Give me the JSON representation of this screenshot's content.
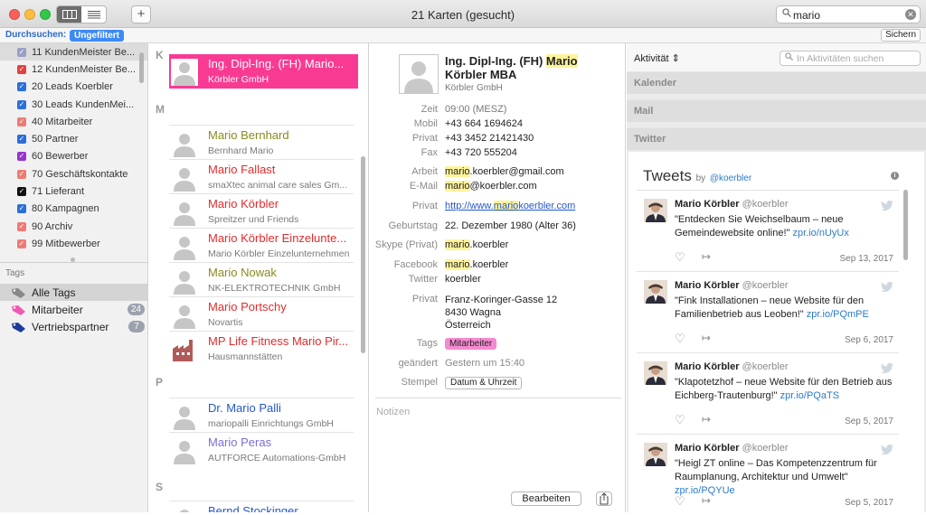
{
  "window": {
    "title": "21 Karten (gesucht)",
    "search_value": "mario",
    "new_button": "+"
  },
  "filter": {
    "label": "Durchsuchen:",
    "pill": "Ungefiltert",
    "save": "Sichern"
  },
  "sidebar": {
    "groups": [
      {
        "label": "11 KundenMeister Be...",
        "color": "#9aa0c4",
        "selected": true
      },
      {
        "label": "12 KundenMeister Be...",
        "color": "#e2413e"
      },
      {
        "label": "20 Leads Koerbler",
        "color": "#2b6fd8"
      },
      {
        "label": "30 Leads KundenMei...",
        "color": "#2b6fd8"
      },
      {
        "label": "40 Mitarbeiter",
        "color": "#ef7a74"
      },
      {
        "label": "50 Partner",
        "color": "#2b6fd8"
      },
      {
        "label": "60 Bewerber",
        "color": "#9a32cf"
      },
      {
        "label": "70 Geschäftskontakte",
        "color": "#ef7a74"
      },
      {
        "label": "71 Lieferant",
        "color": "#111111"
      },
      {
        "label": "80 Kampagnen",
        "color": "#2b6fd8"
      },
      {
        "label": "90 Archiv",
        "color": "#ef7a74"
      },
      {
        "label": "99 Mitbewerber",
        "color": "#ef7a74"
      }
    ],
    "tags_header": "Tags",
    "tags": [
      {
        "label": "Alle Tags",
        "color": "#888888"
      },
      {
        "label": "Mitarbeiter",
        "count": "24",
        "color": "#f05ab2"
      },
      {
        "label": "Vertriebspartner",
        "count": "7",
        "color": "#1d3b9c"
      }
    ]
  },
  "list": {
    "sections": [
      "K",
      "M",
      "P",
      "S"
    ],
    "cards": [
      {
        "name": "Ing. Dipl-Ing. (FH) Mario...",
        "company": "Körbler GmbH",
        "selected": true
      },
      {
        "name": "Mario Bernhard",
        "company": "Bernhard Mario",
        "color": "#8a8a1e"
      },
      {
        "name": "Mario Fallast",
        "company": "smaXtec animal care sales Gm...",
        "color": "#e02c2c"
      },
      {
        "name": "Mario Körbler",
        "company": "Spreitzer und Friends",
        "color": "#e02c2c"
      },
      {
        "name": "Mario Körbler Einzelunte...",
        "company": "Mario Körbler Einzelunternehmen",
        "color": "#e02c2c"
      },
      {
        "name": "Mario Nowak",
        "company": "NK-ELEKTROTECHNIK GmbH",
        "color": "#8a8a1e"
      },
      {
        "name": "Mario Portschy",
        "company": "Novartis",
        "color": "#e02c2c"
      },
      {
        "name": "MP Life Fitness Mario Pir...",
        "company": "Hausmannstätten",
        "color": "#e02c2c",
        "building": true
      },
      {
        "name": "Dr. Mario Palli",
        "company": "mariopalli Einrichtungs GmbH",
        "color": "#2458c9"
      },
      {
        "name": "Mario Peras",
        "company": "AUTFORCE Automations-GmbH",
        "color": "#7a6ed8"
      },
      {
        "name": "Bernd Stockinger",
        "company": "",
        "color": "#2458c9"
      }
    ]
  },
  "detail": {
    "name_prefix": "Ing. Dipl-Ing. (FH) ",
    "name_hl": "Mario",
    "name_suffix": "Körbler MBA",
    "company": "Körbler GmbH",
    "fields": [
      {
        "k": "Zeit",
        "v": "09:00 (MESZ)"
      },
      {
        "k": "Mobil",
        "v": "+43 664 1694624"
      },
      {
        "k": "Privat",
        "v": "+43 3452 21421430"
      },
      {
        "k": "Fax",
        "v": "+43 720 555204"
      },
      {
        "k": "Arbeit",
        "hl": "mario",
        "v": ".koerbler@gmail.com"
      },
      {
        "k": "E-Mail",
        "hl": "mario",
        "v": "@koerbler.com"
      },
      {
        "k": "Privat",
        "link_pre": "http://www.",
        "link_hl": "mario",
        "link_post": "koerbler.com"
      },
      {
        "k": "Geburtstag",
        "v": "22. Dezember 1980 (Alter 36)"
      },
      {
        "k": "Skype (Privat)",
        "hl": "mario",
        "v": ".koerbler"
      },
      {
        "k": "Facebook",
        "hl": "mario",
        "v": ".koerbler"
      },
      {
        "k": "Twitter",
        "v": "koerbler"
      },
      {
        "k": "Privat",
        "addr": [
          "Franz-Koringer-Gasse 12",
          "8430  Wagna",
          "Österreich"
        ]
      },
      {
        "k": "Tags",
        "tag": "Mitarbeiter"
      },
      {
        "k": "geändert",
        "v": "Gestern um 15:40"
      },
      {
        "k": "Stempel",
        "btn": "Datum & Uhrzeit"
      }
    ],
    "notes_placeholder": "Notizen",
    "edit": "Bearbeiten"
  },
  "activity": {
    "selector": "Aktivität",
    "search_placeholder": "In Aktivitäten suchen",
    "sections": [
      "Kalender",
      "Mail",
      "Twitter"
    ],
    "tweets_title": "Tweets",
    "by": "by",
    "handle": "@koerbler",
    "tweets": [
      {
        "name": "Mario Körbler",
        "handle": "@koerbler",
        "text": "\"Entdecken Sie Weichselbaum – neue Gemeindewebsite online!\" ",
        "link": "zpr.io/nUyUx",
        "date": "Sep 13, 2017"
      },
      {
        "name": "Mario Körbler",
        "handle": "@koerbler",
        "text": "\"Fink Installationen – neue Website für den Familienbetrieb aus Leoben!\" ",
        "link": "zpr.io/PQmPE",
        "date": "Sep 6, 2017"
      },
      {
        "name": "Mario Körbler",
        "handle": "@koerbler",
        "text": "\"Klapotetzhof – neue Website für den Betrieb aus Eichberg-Trautenburg!\" ",
        "link": "zpr.io/PQaTS",
        "date": "Sep 5, 2017"
      },
      {
        "name": "Mario Körbler",
        "handle": "@koerbler",
        "text": "\"Heigl ZT online – Das Kompetenzzentrum für Raumplanung, Architektur und Umwelt\" ",
        "link": "zpr.io/PQYUe",
        "date": "Sep 5, 2017"
      }
    ]
  }
}
